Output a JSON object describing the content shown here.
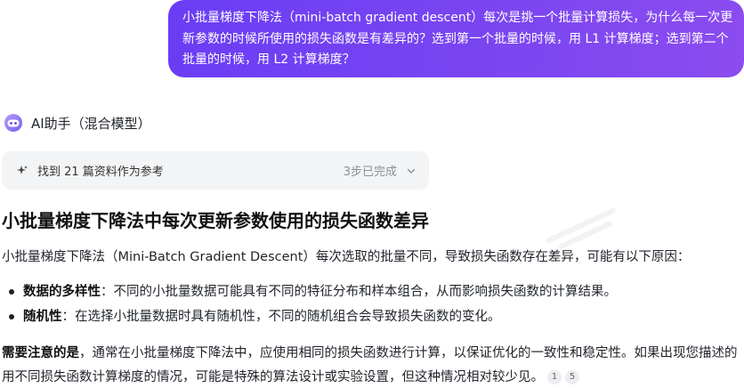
{
  "user_message": {
    "text": "小批量梯度下降法（mini-batch gradient descent）每次是挑一个批量计算损失，为什么每一次更新参数的时候所使用的损失函数是有差异的？选到第一个批量的时候，用 L1 计算梯度；选到第二个批量的时候，用 L2 计算梯度？"
  },
  "assistant": {
    "name": "AI助手（混合模型）",
    "avatar_icon": "bot-avatar-icon"
  },
  "references": {
    "text": "找到 21 篇资料作为参考",
    "steps": "3步已完成"
  },
  "answer": {
    "title": "小批量梯度下降法中每次更新参数使用的损失函数差异",
    "intro": "小批量梯度下降法（Mini-Batch Gradient Descent）每次选取的批量不同，导致损失函数存在差异，可能有以下原因：",
    "bullets": [
      {
        "term": "数据的多样性",
        "text": "：不同的小批量数据可能具有不同的特征分布和样本组合，从而影响损失函数的计算结果。"
      },
      {
        "term": "随机性",
        "text": "：在选择小批量数据时具有随机性，不同的随机组合会导致损失函数的变化。"
      }
    ],
    "note_term": "需要注意的是",
    "note_text": "，通常在小批量梯度下降法中，应使用相同的损失函数进行计算，以保证优化的一致性和稳定性。如果出现您描述的用不同损失函数计算梯度的情况，可能是特殊的算法设计或实验设置，但这种情况相对较少见。",
    "citations": [
      "1",
      "5"
    ]
  },
  "colors": {
    "bubble_start": "#6a3df5",
    "bubble_end": "#8b4cf0",
    "ref_bg": "#f3f4f6"
  }
}
